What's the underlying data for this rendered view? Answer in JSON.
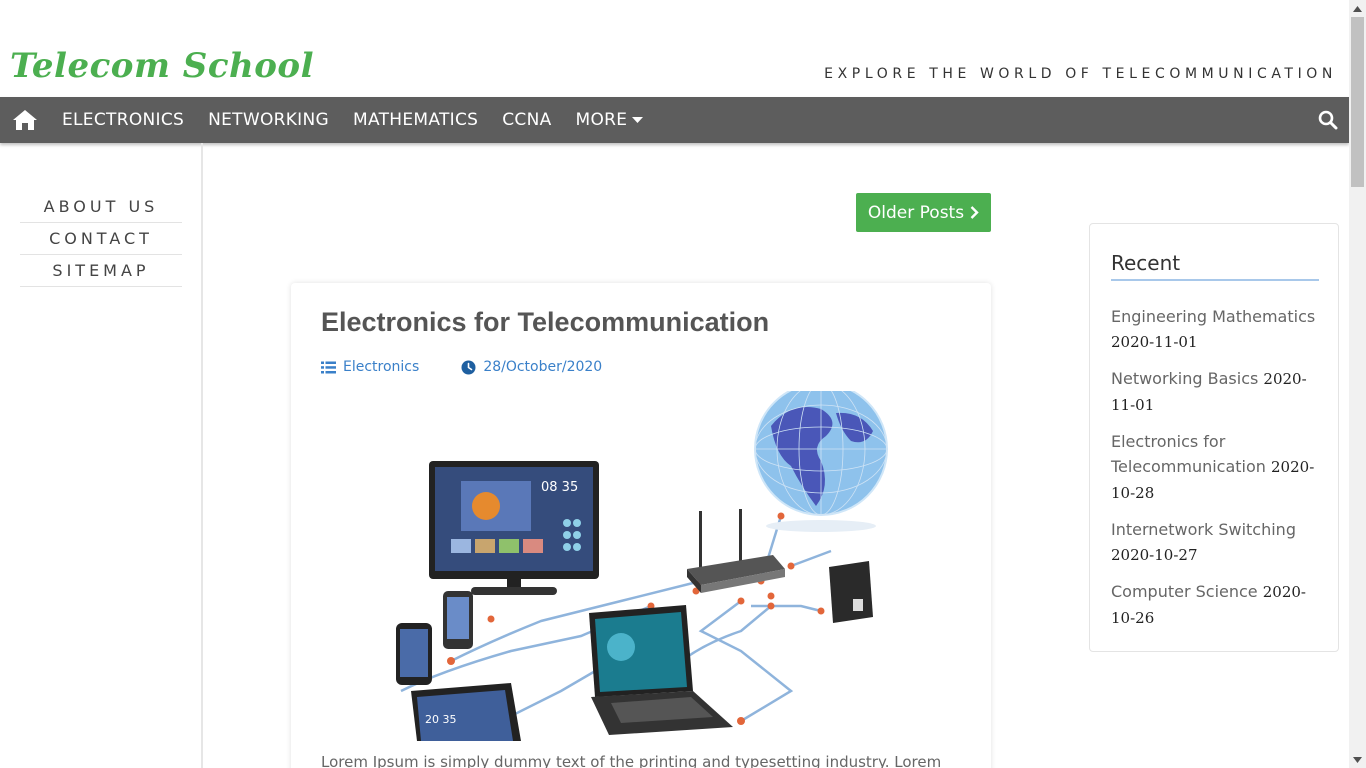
{
  "header": {
    "logo": "Telecom School",
    "tagline": "EXPLORE THE WORLD OF TELECOMMUNICATION"
  },
  "nav": {
    "home_icon": "home-icon",
    "items": [
      "ELECTRONICS",
      "NETWORKING",
      "MATHEMATICS",
      "CCNA"
    ],
    "more_label": "MORE",
    "search_icon": "search-icon",
    "bg_color": "#5d5d5d"
  },
  "left_sidebar": {
    "links": [
      "ABOUT US",
      "CONTACT",
      "SITEMAP"
    ]
  },
  "main": {
    "older_posts_label": "Older Posts",
    "accent_color": "#4caf50",
    "post": {
      "title": "Electronics for Telecommunication",
      "category": "Electronics",
      "date": "28/October/2020",
      "excerpt": "Lorem Ipsum is simply dummy text of the printing and typesetting industry. Lorem"
    }
  },
  "recent": {
    "title": "Recent",
    "items": [
      {
        "title": "Engineering Mathematics",
        "date": "2020-11-01"
      },
      {
        "title": "Networking Basics",
        "date": "2020-11-01"
      },
      {
        "title": "Electronics for Telecommunication",
        "date": "2020-10-28"
      },
      {
        "title": "Internetwork Switching",
        "date": "2020-10-27"
      },
      {
        "title": "Computer Science",
        "date": "2020-10-26"
      }
    ]
  }
}
